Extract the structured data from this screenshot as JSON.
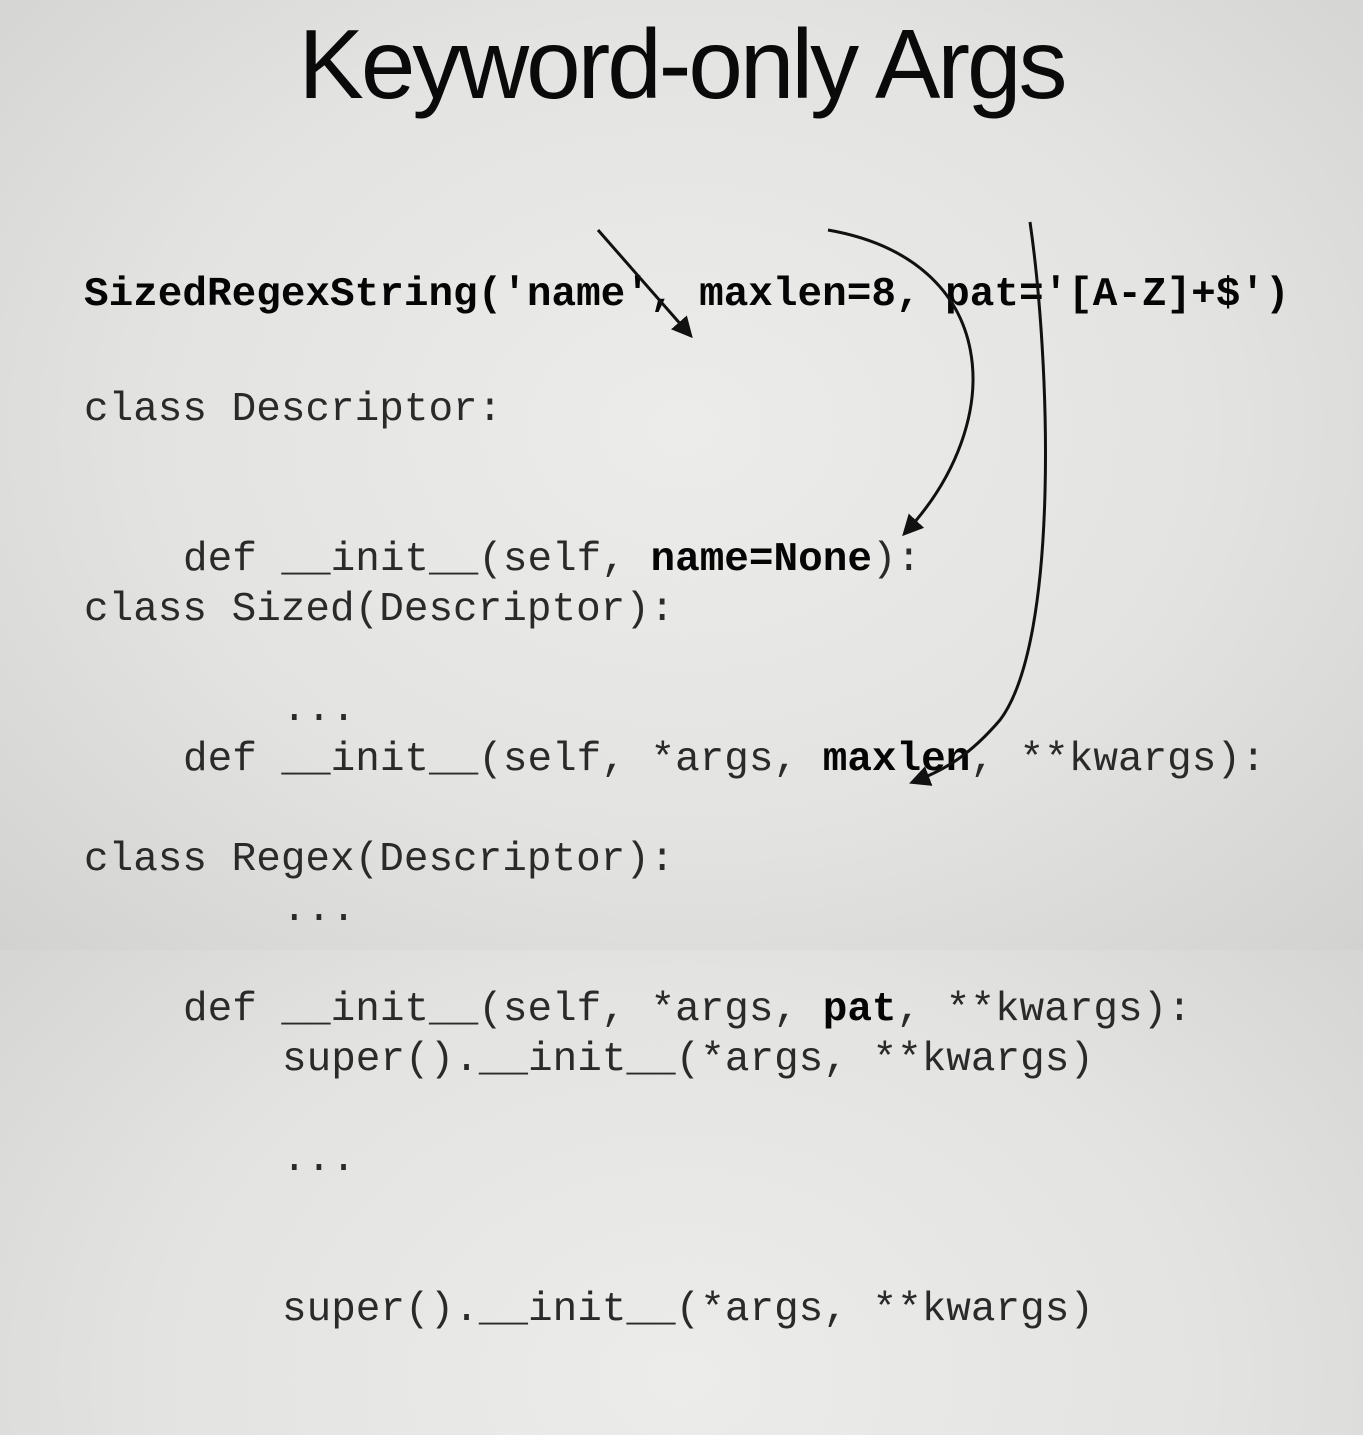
{
  "slide": {
    "title": "Keyword-only Args",
    "call_line": {
      "prefix": "SizedRegexString('name', maxlen=8, pat='[A-Z]+$')"
    },
    "descriptor_class": {
      "header": "class Descriptor:",
      "def_prefix": "def __init__(self, ",
      "def_bold": "name=None",
      "def_suffix": "):",
      "ellipsis": "..."
    },
    "sized_class": {
      "header": "class Sized(Descriptor):",
      "def_prefix": "def __init__(self, *args, ",
      "def_bold": "maxlen",
      "def_suffix": ", **kwargs):",
      "ellipsis": "...",
      "super_line": "super().__init__(*args, **kwargs)"
    },
    "regex_class": {
      "header": "class Regex(Descriptor):",
      "def_prefix": "def __init__(self, *args, ",
      "def_bold": "pat",
      "def_suffix": ", **kwargs):",
      "ellipsis": "...",
      "super_line": "super().__init__(*args, **kwargs)"
    },
    "arrow_color": "#111111"
  }
}
